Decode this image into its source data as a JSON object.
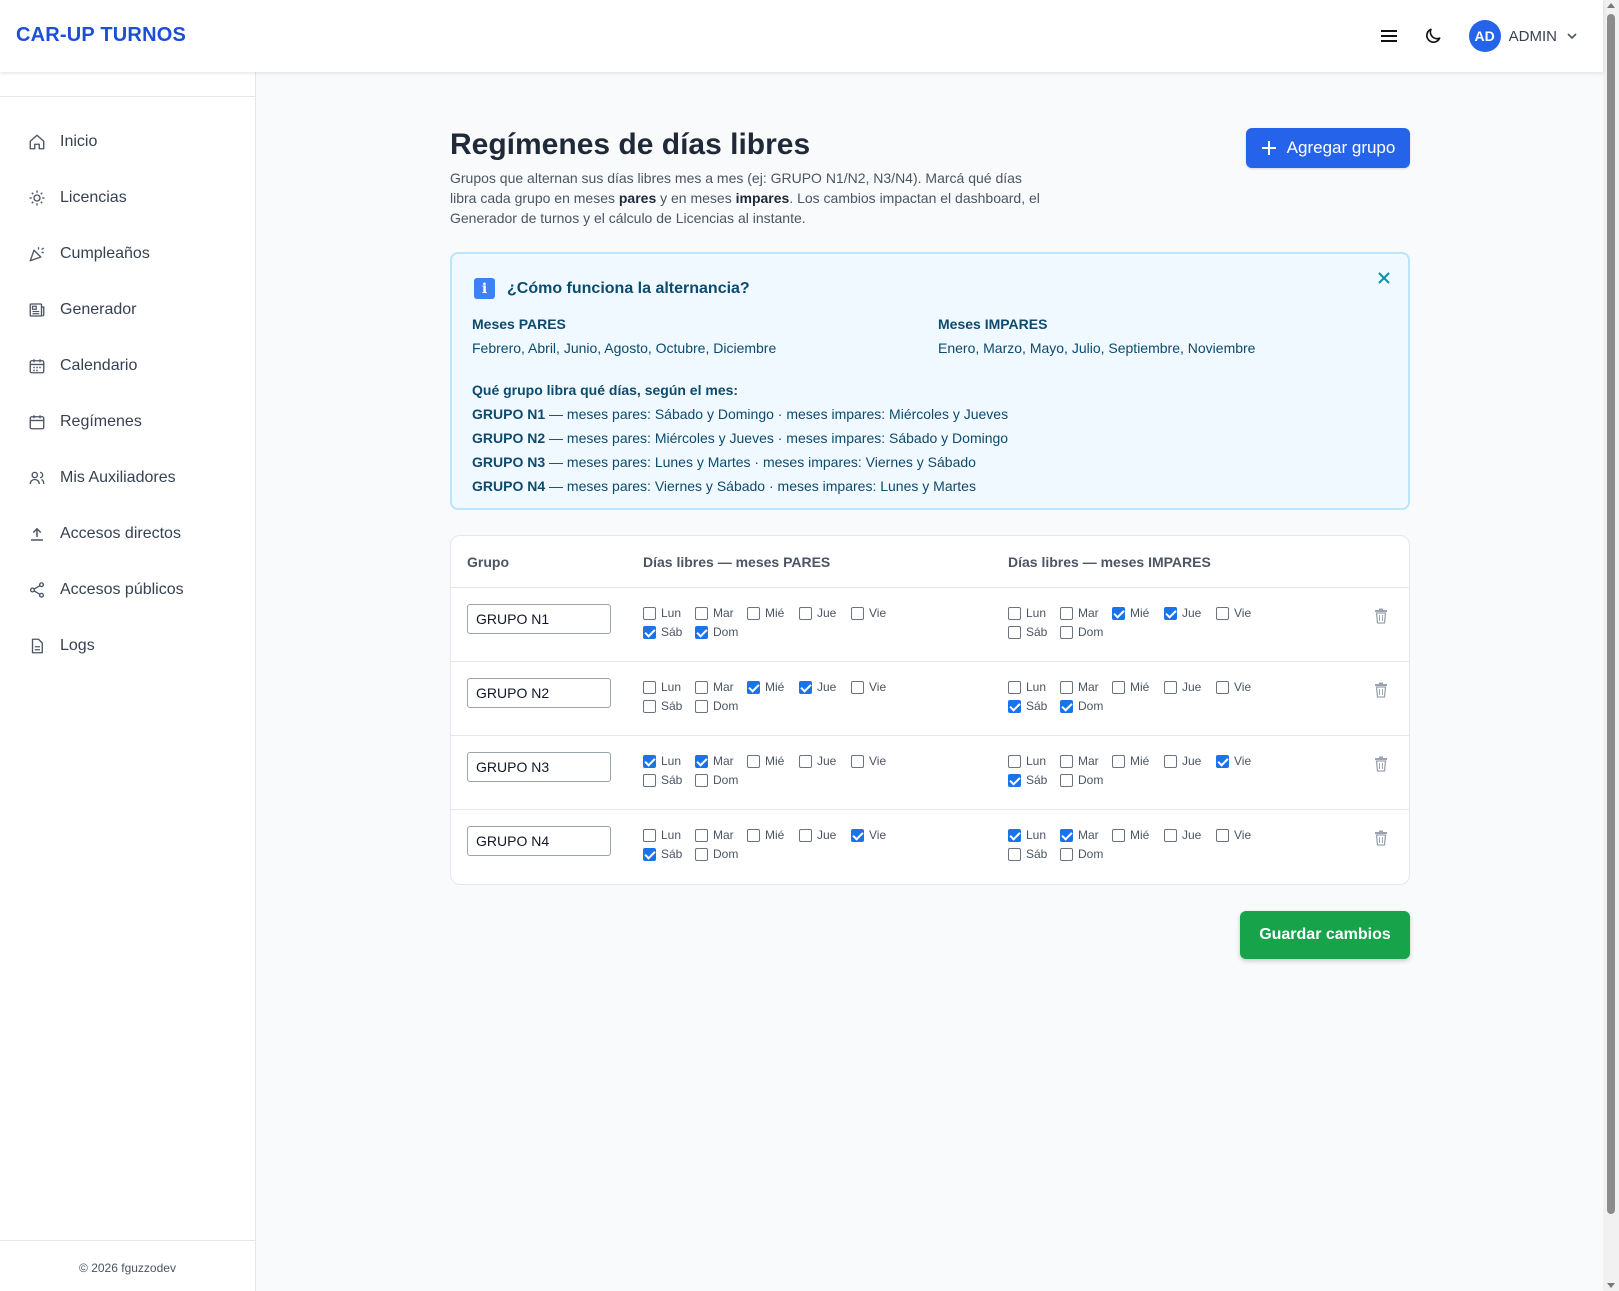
{
  "app": {
    "title": "CAR-UP TURNOS"
  },
  "header": {
    "avatar_initials": "AD",
    "user_label": "ADMIN",
    "icons": [
      "hamburger-menu-icon",
      "moon-icon",
      "chevron-down-icon"
    ]
  },
  "sidebar": {
    "items": [
      {
        "label": "Inicio",
        "icon": "home-icon"
      },
      {
        "label": "Licencias",
        "icon": "sun-icon"
      },
      {
        "label": "Cumpleaños",
        "icon": "party-icon"
      },
      {
        "label": "Generador",
        "icon": "newspaper-icon"
      },
      {
        "label": "Calendario",
        "icon": "calendar-icon"
      },
      {
        "label": "Regímenes",
        "icon": "calendar-outline-icon"
      },
      {
        "label": "Mis Auxiliadores",
        "icon": "users-icon"
      },
      {
        "label": "Accesos directos",
        "icon": "upload-icon"
      },
      {
        "label": "Accesos públicos",
        "icon": "share-icon"
      },
      {
        "label": "Logs",
        "icon": "document-icon"
      }
    ],
    "footer": "© 2026 fguzzodev"
  },
  "page": {
    "title": "Regímenes de días libres",
    "desc_1": "Grupos que alternan sus días libres mes a mes (ej: GRUPO N1/N2, N3/N4). Marcá qué días libra cada grupo en meses ",
    "desc_pares": "pares",
    "desc_2": " y en meses ",
    "desc_impares": "impares",
    "desc_3": ". Los cambios impactan el dashboard, el Generador de turnos y el cálculo de Licencias al instante.",
    "add_button": "Agregar grupo",
    "save_button": "Guardar cambios"
  },
  "info": {
    "title": "¿Cómo funciona la alternancia?",
    "even_heading": "Meses PARES",
    "even_months": "Febrero, Abril, Junio, Agosto, Octubre, Diciembre",
    "odd_heading": "Meses IMPARES",
    "odd_months": "Enero, Marzo, Mayo, Julio, Septiembre, Noviembre",
    "rules_heading": "Qué grupo libra qué días, según el mes:",
    "rules": [
      {
        "group": "GRUPO N1",
        "text": " — meses pares: Sábado y Domingo · meses impares: Miércoles y Jueves"
      },
      {
        "group": "GRUPO N2",
        "text": " — meses pares: Miércoles y Jueves · meses impares: Sábado y Domingo"
      },
      {
        "group": "GRUPO N3",
        "text": " — meses pares: Lunes y Martes · meses impares: Viernes y Sábado"
      },
      {
        "group": "GRUPO N4",
        "text": " — meses pares: Viernes y Sábado · meses impares: Lunes y Martes"
      }
    ]
  },
  "table": {
    "headers": {
      "group": "Grupo",
      "even": "Días libres — meses PARES",
      "odd": "Días libres — meses IMPARES"
    },
    "day_labels": [
      "Lun",
      "Mar",
      "Mié",
      "Jue",
      "Vie",
      "Sáb",
      "Dom"
    ],
    "rows": [
      {
        "name": "GRUPO N1",
        "even": [
          false,
          false,
          false,
          false,
          false,
          true,
          true
        ],
        "odd": [
          false,
          false,
          true,
          true,
          false,
          false,
          false
        ]
      },
      {
        "name": "GRUPO N2",
        "even": [
          false,
          false,
          true,
          true,
          false,
          false,
          false
        ],
        "odd": [
          false,
          false,
          false,
          false,
          false,
          true,
          true
        ]
      },
      {
        "name": "GRUPO N3",
        "even": [
          true,
          true,
          false,
          false,
          false,
          false,
          false
        ],
        "odd": [
          false,
          false,
          false,
          false,
          true,
          true,
          false
        ]
      },
      {
        "name": "GRUPO N4",
        "even": [
          false,
          false,
          false,
          false,
          true,
          true,
          false
        ],
        "odd": [
          true,
          true,
          false,
          false,
          false,
          false,
          false
        ]
      }
    ]
  },
  "colors": {
    "brand": "#1d4ed8",
    "primary": "#2563eb",
    "success": "#16a34a",
    "info_bg": "#f0f9ff",
    "info_border": "#bae6fd",
    "info_text": "#0c4a6e"
  }
}
